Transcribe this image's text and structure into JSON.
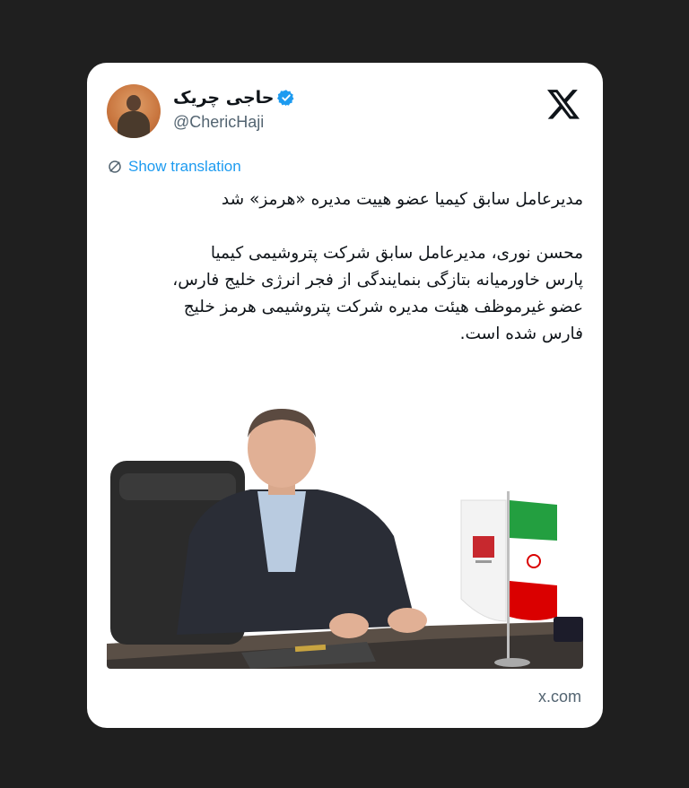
{
  "tweet": {
    "display_name": "حاجی چریک",
    "handle": "@ChericHaji",
    "translate_label": "Show translation",
    "headline": "مدیرعامل سابق کیمیا عضو هییت مدیره «هرمز» شد",
    "body": "محسن نوری، مدیرعامل سابق شرکت پتروشیمی کیمیا\nپارس خاورمیانه بتازگی بنمایندگی از فجر انرژی خلیج فارس،\nعضو غیرموظف هیئت مدیره شرکت پتروشیمی هرمز خلیج\nفارس شده است.",
    "source": "x.com"
  },
  "icons": {
    "logo": "x-logo-icon",
    "verified": "verified-badge-icon",
    "translate": "translate-globe-icon"
  },
  "colors": {
    "page_background": "#1f1f1f",
    "card_background": "#ffffff",
    "link": "#1d9bf0",
    "verified": "#1d9bf0",
    "muted_text": "#536471"
  }
}
